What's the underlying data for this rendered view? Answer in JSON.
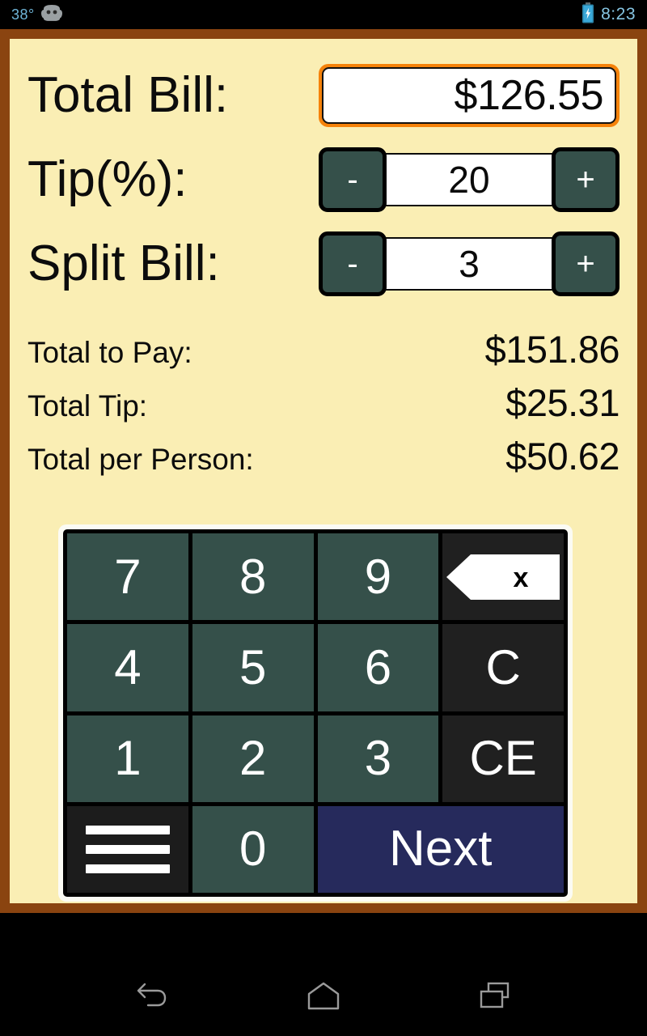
{
  "status_bar": {
    "temperature": "38°",
    "droid_icon": "android-droid-icon",
    "battery_icon": "battery-charging-icon",
    "clock": "8:23"
  },
  "app": {
    "fields": [
      {
        "label": "Total Bill:",
        "value": "$126.55",
        "type": "text",
        "focused": true
      },
      {
        "label": "Tip(%):",
        "value": "20",
        "type": "stepper",
        "minus": "-",
        "plus": "+"
      },
      {
        "label": "Split Bill:",
        "value": "3",
        "type": "stepper",
        "minus": "-",
        "plus": "+"
      }
    ],
    "summary": [
      {
        "label": "Total to Pay:",
        "value": "$151.86"
      },
      {
        "label": "Total Tip:",
        "value": "$25.31"
      },
      {
        "label": "Total per Person:",
        "value": "$50.62"
      }
    ],
    "keypad": [
      {
        "label": "7",
        "name": "key-7",
        "style": "num"
      },
      {
        "label": "8",
        "name": "key-8",
        "style": "num"
      },
      {
        "label": "9",
        "name": "key-9",
        "style": "num"
      },
      {
        "label": "",
        "name": "backspace-key",
        "style": "dark",
        "icon": "backspace-icon"
      },
      {
        "label": "4",
        "name": "key-4",
        "style": "num"
      },
      {
        "label": "5",
        "name": "key-5",
        "style": "num"
      },
      {
        "label": "6",
        "name": "key-6",
        "style": "num"
      },
      {
        "label": "C",
        "name": "clear-key",
        "style": "dark"
      },
      {
        "label": "1",
        "name": "key-1",
        "style": "num"
      },
      {
        "label": "2",
        "name": "key-2",
        "style": "num"
      },
      {
        "label": "3",
        "name": "key-3",
        "style": "num"
      },
      {
        "label": "CE",
        "name": "clear-entry-key",
        "style": "dark"
      },
      {
        "label": "",
        "name": "menu-key",
        "style": "menu",
        "icon": "hamburger-menu-icon"
      },
      {
        "label": "0",
        "name": "key-0",
        "style": "num"
      },
      {
        "label": "Next",
        "name": "next-button",
        "style": "next"
      }
    ]
  },
  "nav_bar": {
    "back": "back-icon",
    "home": "home-icon",
    "recents": "recents-icon"
  },
  "colors": {
    "app_background": "#faeeb4",
    "app_border": "#8a4410",
    "key_green": "#35504a",
    "key_dark": "#202020",
    "next_navy": "#262a5c",
    "focus_orange": "#f5820b",
    "status_blue": "#86c5e2"
  }
}
